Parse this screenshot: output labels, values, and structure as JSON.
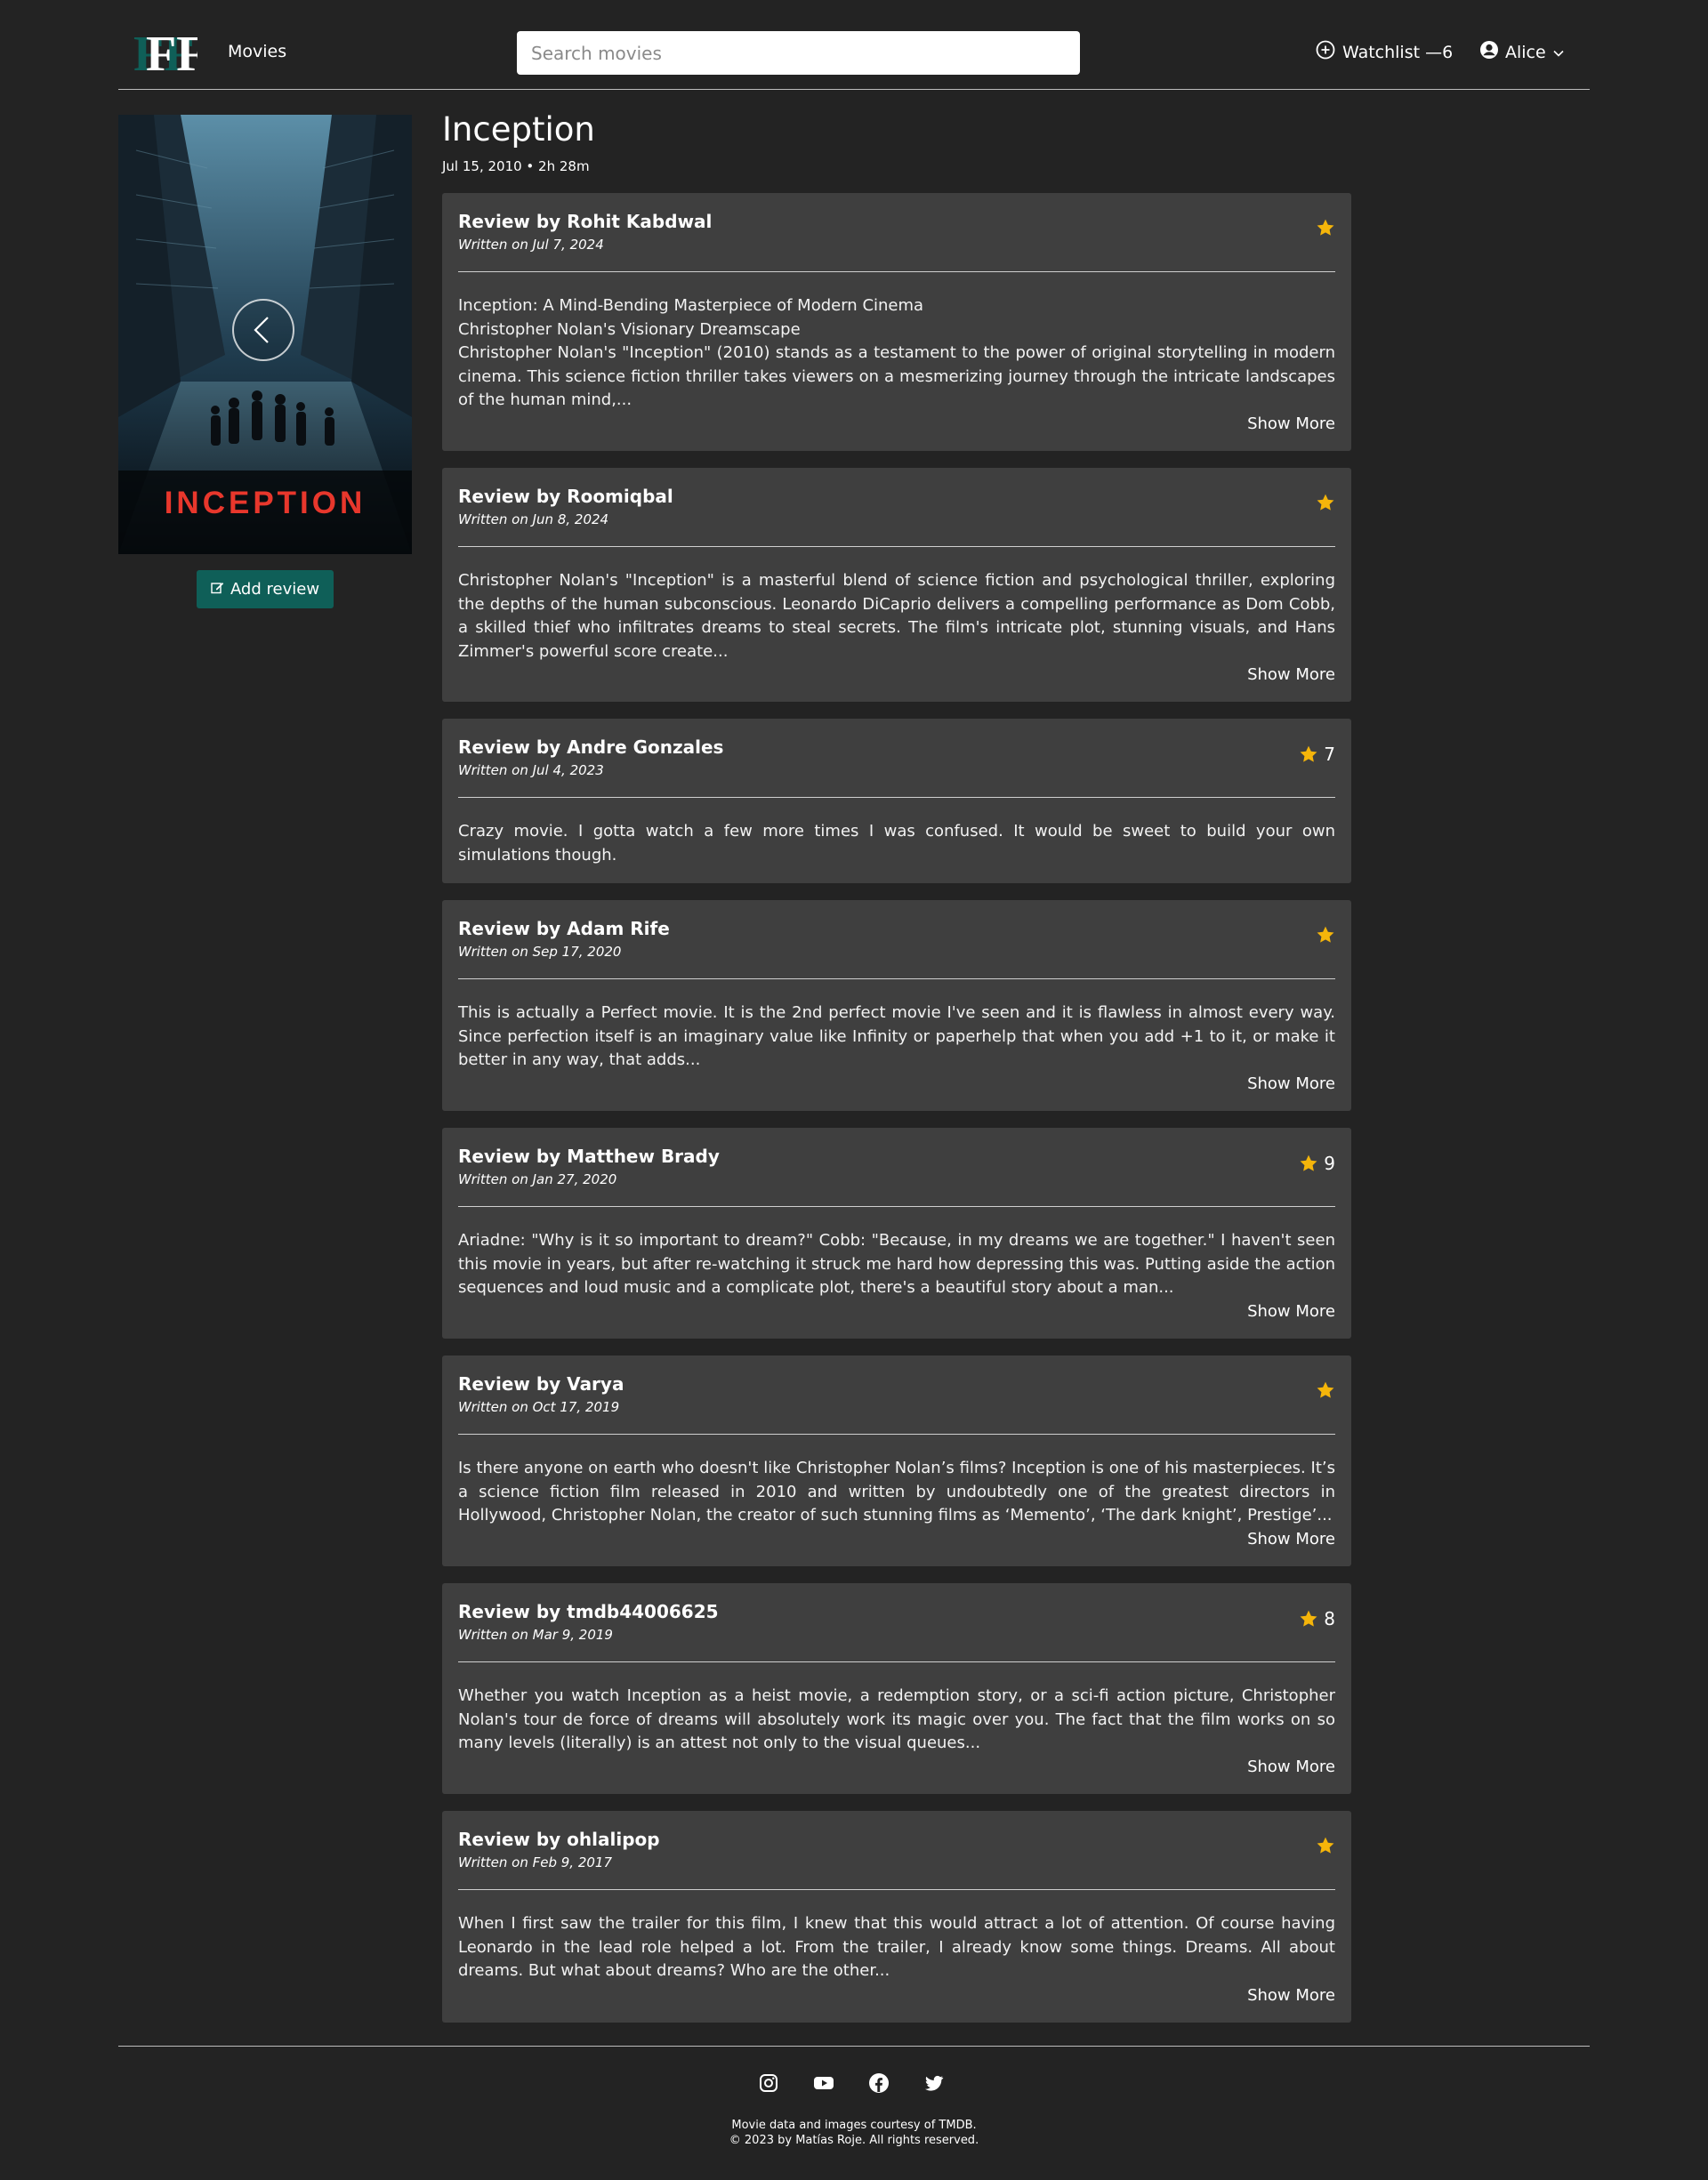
{
  "header": {
    "logo_text": "FF",
    "nav_movies": "Movies",
    "search_placeholder": "Search movies",
    "watchlist_label": "Watchlist —6",
    "user_name": "Alice"
  },
  "movie": {
    "poster_title": "INCEPTION",
    "title": "Inception",
    "meta": "Jul 15, 2010 • 2h 28m",
    "add_review_label": "Add review"
  },
  "reviews": [
    {
      "author": "Review by Rohit Kabdwal",
      "date": "Written on Jul 7, 2024",
      "rating": "",
      "lines": [
        "Inception: A Mind-Bending Masterpiece of Modern Cinema",
        "Christopher Nolan's Visionary Dreamscape",
        "Christopher Nolan's \"Inception\" (2010) stands as a testament to the power of original storytelling in modern cinema. This science fiction thriller takes viewers on a mesmerizing journey through the intricate landscapes of the human mind,..."
      ],
      "show_more": "Show More"
    },
    {
      "author": "Review by Roomiqbal",
      "date": "Written on Jun 8, 2024",
      "rating": "",
      "lines": [
        "Christopher Nolan's \"Inception\" is a masterful blend of science fiction and psychological thriller, exploring the depths of the human subconscious. Leonardo DiCaprio delivers a compelling performance as Dom Cobb, a skilled thief who infiltrates dreams to steal secrets. The film's intricate plot, stunning visuals, and Hans Zimmer's powerful score create..."
      ],
      "show_more": "Show More"
    },
    {
      "author": "Review by Andre Gonzales",
      "date": "Written on Jul 4, 2023",
      "rating": "7",
      "lines": [
        "Crazy movie. I gotta watch a few more times I was confused. It would be sweet to build your own simulations though."
      ],
      "show_more": ""
    },
    {
      "author": "Review by Adam Rife",
      "date": "Written on Sep 17, 2020",
      "rating": "",
      "lines": [
        "This is actually a Perfect movie. It is the 2nd perfect movie I've seen and it is flawless in almost every way. Since perfection itself is an imaginary value like Infinity or paperhelp that when you add +1 to it, or make it better in any way, that adds..."
      ],
      "show_more": "Show More"
    },
    {
      "author": "Review by Matthew Brady",
      "date": "Written on Jan 27, 2020",
      "rating": "9",
      "lines": [
        "Ariadne: \"Why is it so important to dream?\" Cobb: \"Because, in my dreams we are together.\" I haven't seen this movie in years, but after re-watching it struck me hard how depressing this was. Putting aside the action sequences and loud music and a complicate plot, there's a beautiful story about a man..."
      ],
      "show_more": "Show More"
    },
    {
      "author": "Review by Varya",
      "date": "Written on Oct 17, 2019",
      "rating": "",
      "lines": [
        "Is there anyone on earth who doesn't like Christopher Nolan’s films? Inception is one of his masterpieces. It’s a science fiction film released in 2010 and written by undoubtedly one of the greatest directors in Hollywood, Christopher Nolan, the creator of such stunning films as ‘Memento’, ‘The dark knight’, Prestige’..."
      ],
      "show_more": "Show More"
    },
    {
      "author": "Review by tmdb44006625",
      "date": "Written on Mar 9, 2019",
      "rating": "8",
      "lines": [
        "Whether you watch Inception as a heist movie, a redemption story, or a sci-fi action picture, Christopher Nolan's tour de force of dreams will absolutely work its magic over you. The fact that the film works on so many levels (literally) is an attest not only to the visual queues..."
      ],
      "show_more": "Show More"
    },
    {
      "author": "Review by ohlalipop",
      "date": "Written on Feb 9, 2017",
      "rating": "",
      "lines": [
        "When I first saw the trailer for this film, I knew that this would attract a lot of attention. Of course having Leonardo in the lead role helped a lot. From the trailer, I already know some things. Dreams. All about dreams. But what about dreams? Who are the other..."
      ],
      "show_more": "Show More"
    }
  ],
  "footer": {
    "credit": "Movie data and images courtesy of TMDB.",
    "copyright": "© 2023 by Matías Roje. All rights reserved.",
    "socials": [
      "instagram-icon",
      "youtube-icon",
      "facebook-icon",
      "twitter-icon"
    ]
  },
  "colors": {
    "background": "#232323",
    "card": "#3f3f3f",
    "accent": "#0f5f58",
    "star": "#f5b50a",
    "poster_title": "#e8372c"
  }
}
